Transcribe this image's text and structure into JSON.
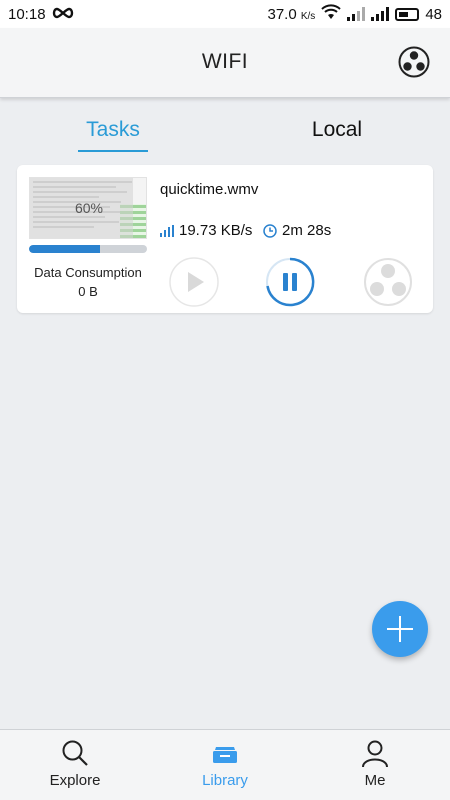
{
  "status_bar": {
    "time": "10:18",
    "net_speed": "37.0",
    "net_speed_unit": "K/s",
    "network_type": "4G",
    "battery": "48"
  },
  "header": {
    "title": "WIFI"
  },
  "tabs": [
    {
      "label": "Tasks",
      "active": true
    },
    {
      "label": "Local",
      "active": false
    }
  ],
  "task": {
    "filename": "quicktime.wmv",
    "progress_label": "60%",
    "progress_fraction": 0.6,
    "speed": "19.73 KB/s",
    "time_remaining": "2m 28s",
    "data_consumption_label": "Data Consumption",
    "data_consumption_value": "0 B"
  },
  "bottom_nav": [
    {
      "label": "Explore",
      "icon": "search-icon",
      "active": false
    },
    {
      "label": "Library",
      "icon": "library-icon",
      "active": true
    },
    {
      "label": "Me",
      "icon": "person-icon",
      "active": false
    }
  ],
  "colors": {
    "accent": "#2a9bd6",
    "fab": "#3a9cec",
    "progress": "#2a82cf",
    "background": "#eceef1"
  }
}
